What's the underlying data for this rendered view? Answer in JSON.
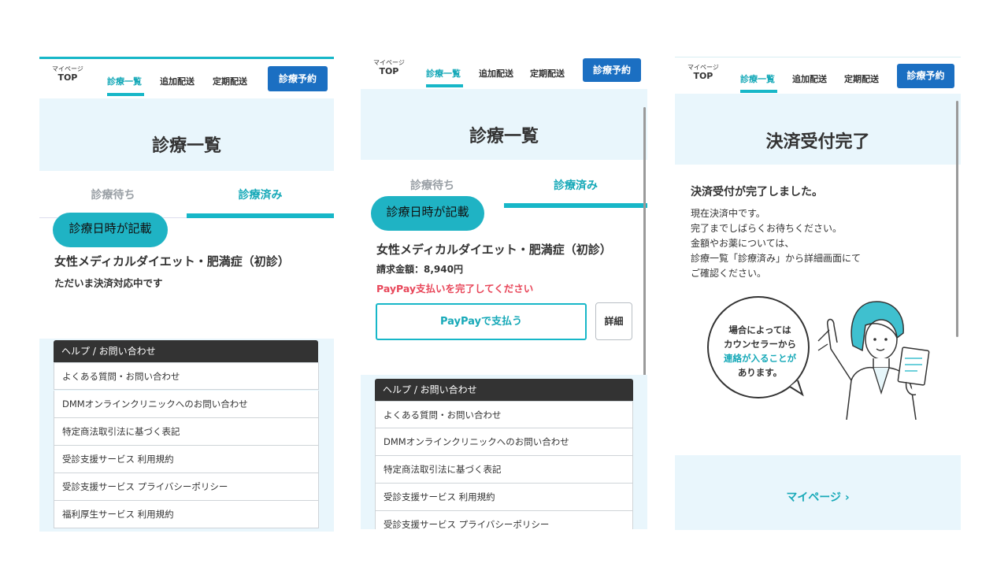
{
  "nav": {
    "mypage_small": "マイページ",
    "mypage_top": "TOP",
    "items": [
      "診療一覧",
      "追加配送",
      "定期配送"
    ],
    "reserve": "診療予約"
  },
  "screen1": {
    "title": "診療一覧",
    "tab_waiting": "診療待ち",
    "tab_done": "診療済み",
    "bubble": "診療日時が記載",
    "course": "女性メディカルダイエット・肥満症（初診）",
    "status": "ただいま決済対応中です"
  },
  "screen2": {
    "title": "診療一覧",
    "tab_waiting": "診療待ち",
    "tab_done": "診療済み",
    "bubble": "診療日時が記載",
    "course": "女性メディカルダイエット・肥満症（初診）",
    "amount": "請求金額：8,940円",
    "warning": "PayPay支払いを完了してください",
    "pay_button": "PayPayで支払う",
    "detail_button": "詳細"
  },
  "help": {
    "header": "ヘルプ / お問い合わせ",
    "items": [
      "よくある質問・お問い合わせ",
      "DMMオンラインクリニックへのお問い合わせ",
      "特定商法取引法に基づく表記",
      "受診支援サービス 利用規約",
      "受診支援サービス プライバシーポリシー",
      "福利厚生サービス 利用規約"
    ]
  },
  "screen3": {
    "title": "決済受付完了",
    "heading": "決済受付が完了しました。",
    "body": [
      "現在決済中です。",
      "完了までしばらくお待ちください。",
      "金額やお薬については、",
      "診療一覧「診療済み」から詳細画面にて",
      "ご確認ください。"
    ],
    "speech": [
      "場合によっては",
      "カウンセラーから",
      "連絡が入ることが",
      "あります。"
    ],
    "mypage_link": "マイページ ›"
  },
  "colors": {
    "accent": "#17b7c8",
    "reserve": "#1b6fc2",
    "warning": "#e8475a",
    "hero_bg": "#e9f6fc"
  }
}
